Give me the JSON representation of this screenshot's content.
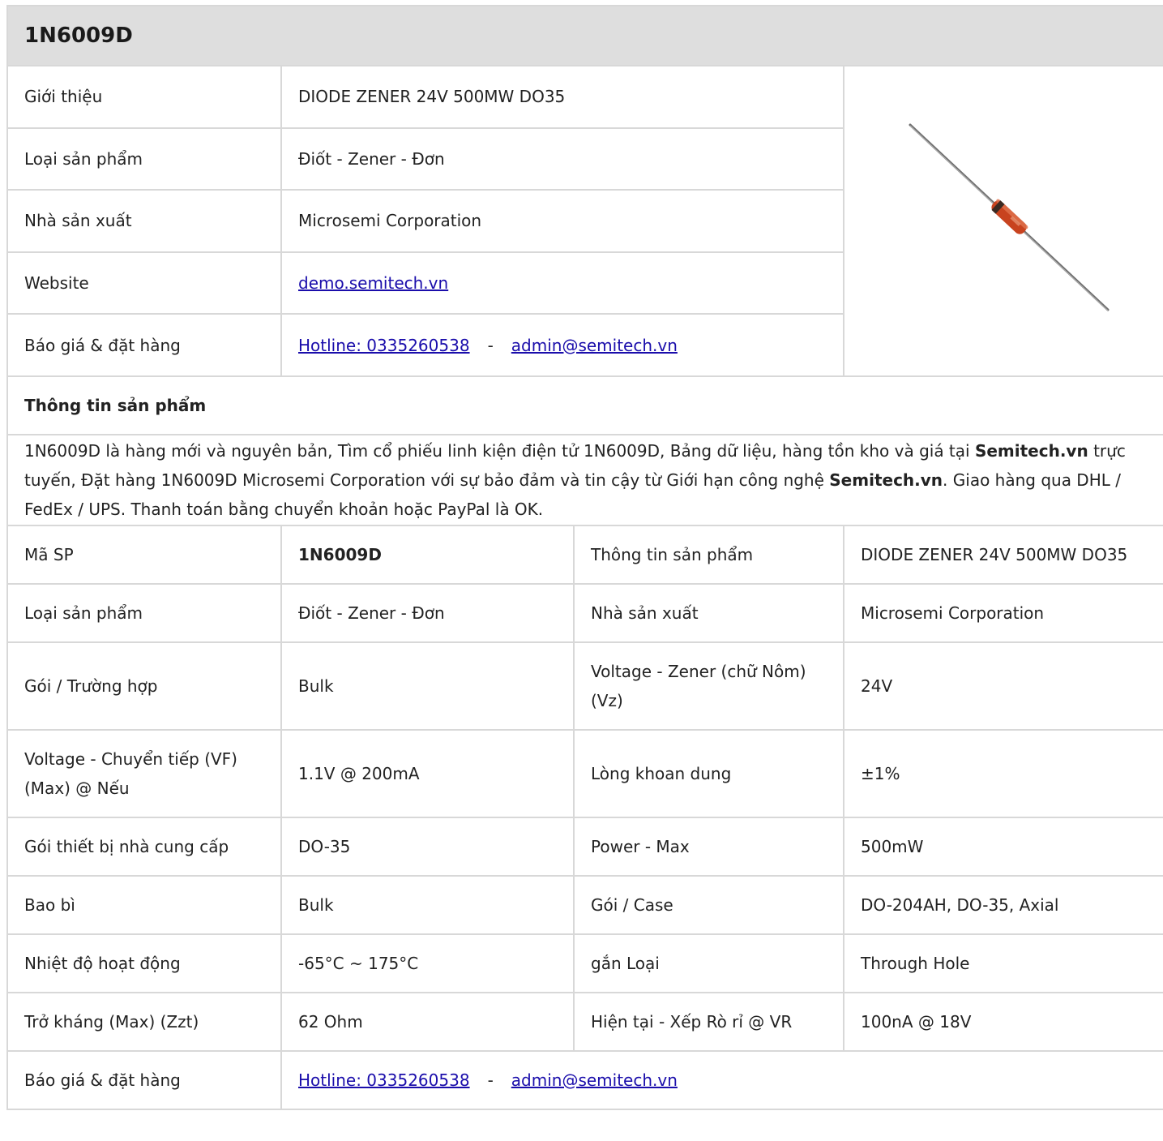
{
  "title": "1N6009D",
  "intro": {
    "rows": [
      {
        "label": "Giới thiệu",
        "value": "DIODE ZENER 24V 500MW DO35"
      },
      {
        "label": "Loại sản phẩm",
        "value": "Điốt - Zener - Đơn"
      },
      {
        "label": "Nhà sản xuất",
        "value": "Microsemi Corporation"
      }
    ],
    "website_label": "Website",
    "website_link": "demo.semitech.vn",
    "order_label": "Báo giá & đặt hàng",
    "hotline": "Hotline: 0335260538",
    "separator": "-",
    "email": "admin@semitech.vn"
  },
  "section_title": "Thông tin sản phẩm",
  "description": {
    "p1": "1N6009D là hàng mới và nguyên bản, Tìm cổ phiếu linh kiện điện tử 1N6009D, Bảng dữ liệu, hàng tồn kho và giá tại ",
    "brand1": "Semitech.vn",
    "p2": " trực tuyến, Đặt hàng 1N6009D Microsemi Corporation với sự bảo đảm và tin cậy từ Giới hạn công nghệ ",
    "brand2": "Semitech.vn",
    "p3": ". Giao hàng qua DHL / FedEx / UPS. Thanh toán bằng chuyển khoản hoặc PayPal là OK."
  },
  "specs": [
    {
      "l1": "Mã SP",
      "v1": "1N6009D",
      "l2": "Thông tin sản phẩm",
      "v2": "DIODE ZENER 24V 500MW DO35"
    },
    {
      "l1": "Loại sản phẩm",
      "v1": "Điốt - Zener - Đơn",
      "l2": "Nhà sản xuất",
      "v2": "Microsemi Corporation"
    },
    {
      "l1": "Gói / Trường hợp",
      "v1": "Bulk",
      "l2": "Voltage - Zener (chữ Nôm) (Vz)",
      "v2": "24V"
    },
    {
      "l1": "Voltage - Chuyển tiếp (VF) (Max) @ Nếu",
      "v1": "1.1V @ 200mA",
      "l2": "Lòng khoan dung",
      "v2": "±1%"
    },
    {
      "l1": "Gói thiết bị nhà cung cấp",
      "v1": "DO-35",
      "l2": "Power - Max",
      "v2": "500mW"
    },
    {
      "l1": "Bao bì",
      "v1": "Bulk",
      "l2": "Gói / Case",
      "v2": "DO-204AH, DO-35, Axial"
    },
    {
      "l1": "Nhiệt độ hoạt động",
      "v1": "-65°C ~ 175°C",
      "l2": "gắn Loại",
      "v2": "Through Hole"
    },
    {
      "l1": "Trở kháng (Max) (Zzt)",
      "v1": "62 Ohm",
      "l2": "Hiện tại - Xếp Rò rỉ @ VR",
      "v2": "100nA @ 18V"
    }
  ],
  "footer": {
    "label": "Báo giá & đặt hàng",
    "hotline": "Hotline: 0335260538",
    "separator": "-",
    "email": "admin@semitech.vn"
  },
  "colors": {
    "header_bg": "#dedede",
    "border": "#d8d8d8",
    "link": "#1a0dab",
    "diode_body": "#c8431f"
  }
}
